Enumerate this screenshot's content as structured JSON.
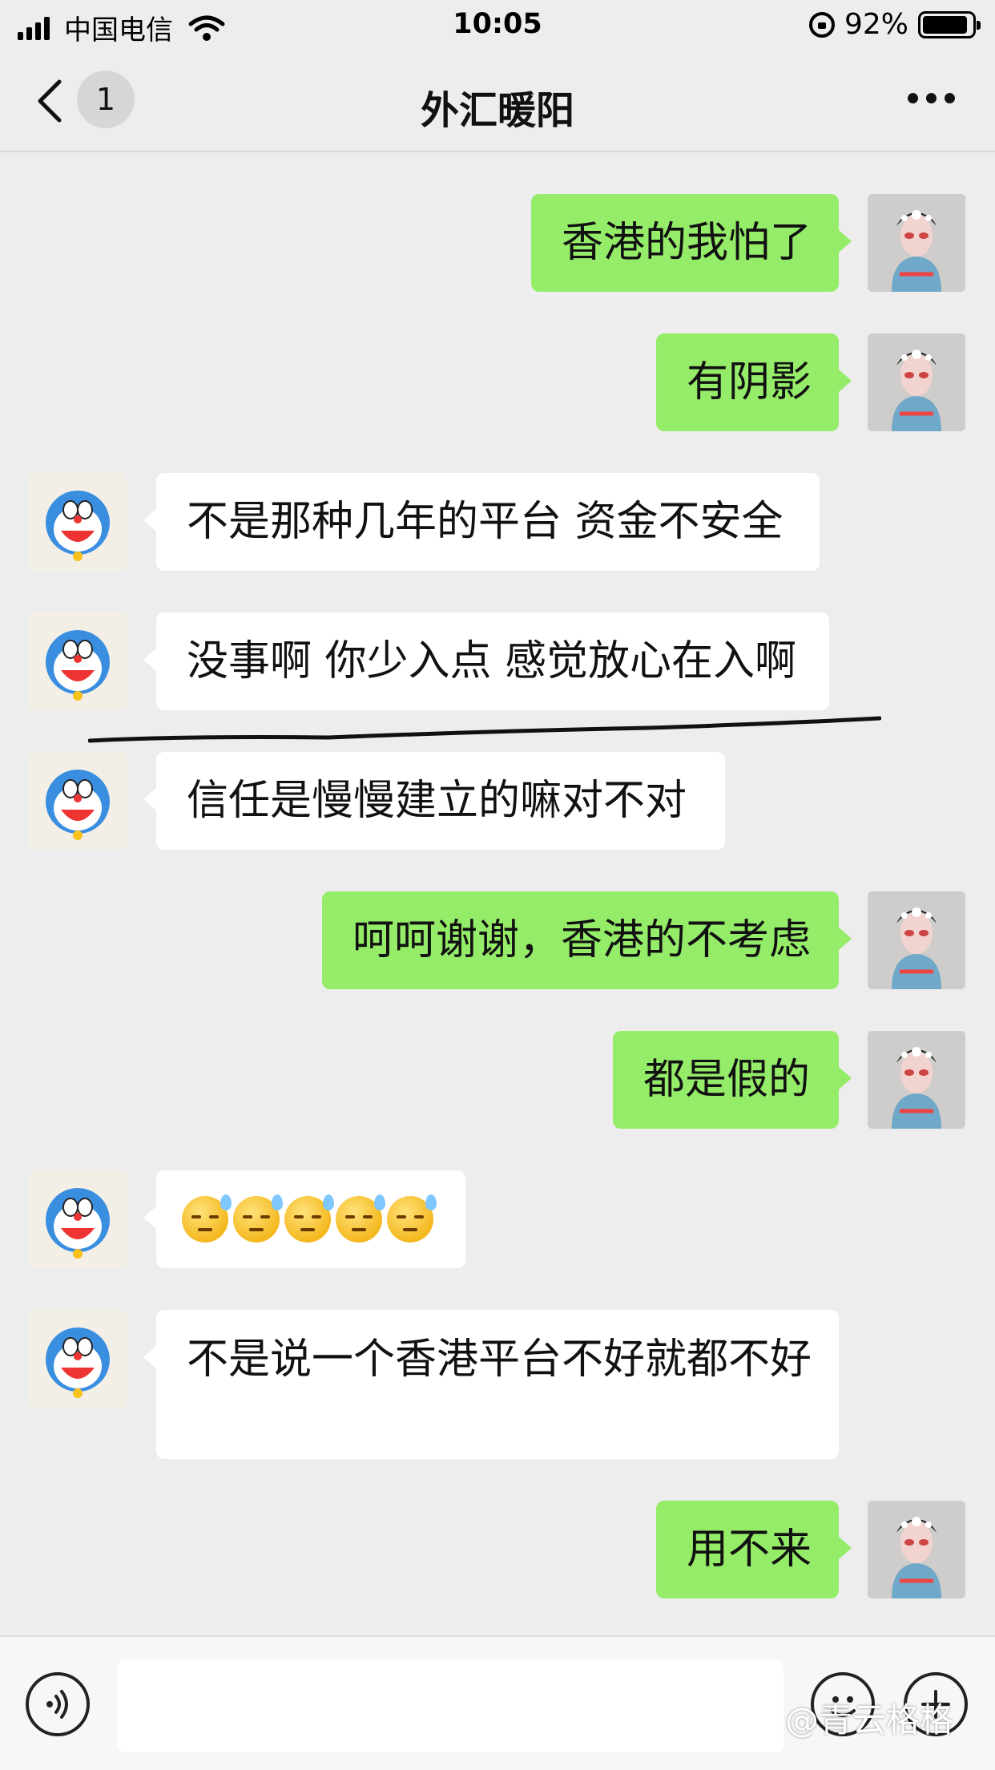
{
  "status_bar": {
    "carrier": "中国电信",
    "time": "10:05",
    "battery": "92%",
    "battery_level": 0.92
  },
  "header": {
    "back_icon": "chevron-left-icon",
    "unread_count": "1",
    "title": "外汇暖阳",
    "more_icon": "more-dots-icon"
  },
  "messages": [
    {
      "side": "right",
      "text": "香港的我怕了"
    },
    {
      "side": "right",
      "text": "有阴影"
    },
    {
      "side": "left",
      "text": "不是那种几年的平台 资金不安全"
    },
    {
      "side": "left",
      "text": "没事啊 你少入点 感觉放心在入啊"
    },
    {
      "side": "left",
      "text": "信任是慢慢建立的嘛对不对"
    },
    {
      "side": "right",
      "text": "呵呵谢谢，香港的不考虑"
    },
    {
      "side": "right",
      "text": "都是假的"
    },
    {
      "side": "left",
      "emoji": "sweat-expressionless-emoji",
      "emoji_count": 5
    },
    {
      "side": "left",
      "text": "不是说一个香港平台不好就都不好"
    },
    {
      "side": "right",
      "text": "用不来"
    }
  ],
  "input_bar": {
    "voice_icon": "voice-icon",
    "text_value": "",
    "emoji_icon": "smiley-icon",
    "plus_icon": "plus-icon"
  },
  "watermark": "@青云格格",
  "colors": {
    "background": "#ededed",
    "outgoing_bubble": "#95ec69",
    "incoming_bubble": "#ffffff"
  }
}
